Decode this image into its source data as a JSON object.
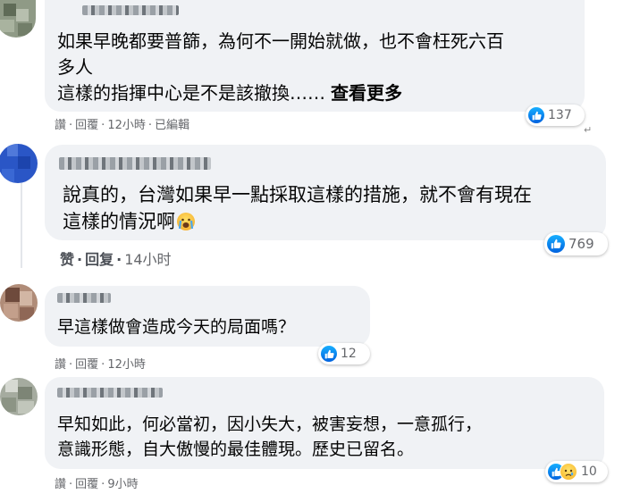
{
  "comments": [
    {
      "lines": [
        "如果早晚都要普篩，為何不一開始就做，也不會枉死六百",
        "多人",
        "這樣的指揮中心是不是該撤換……"
      ],
      "see_more": "查看更多",
      "actions": {
        "like": "讚",
        "reply": "回覆",
        "time": "12小時",
        "edited": "已編輯"
      },
      "reactions": {
        "icons": [
          "like-icon"
        ],
        "count": "137"
      }
    },
    {
      "lines": [
        "說真的，台灣如果早一點採取這樣的措施，就不會有現在",
        "這樣的情況啊"
      ],
      "emoji": "crying-face-icon",
      "actions": {
        "like": "赞",
        "reply": "回复",
        "time": "14小时"
      },
      "reactions": {
        "icons": [
          "like-icon"
        ],
        "count": "769"
      }
    },
    {
      "lines": [
        "早這樣做會造成今天的局面嗎？"
      ],
      "actions": {
        "like": "讚",
        "reply": "回覆",
        "time": "12小時"
      },
      "reactions": {
        "icons": [
          "like-icon"
        ],
        "count": "12"
      }
    },
    {
      "lines": [
        "早知如此，何必當初，因小失大，被害妄想，一意孤行，",
        "意識形態，自大傲慢的最佳體現。歷史已留名。"
      ],
      "actions": {
        "like": "讚",
        "reply": "回覆",
        "time": "9小時"
      },
      "reactions": {
        "icons": [
          "like-icon",
          "sad-icon"
        ],
        "count": "10"
      }
    }
  ],
  "colors": {
    "bubble": "#f0f2f5",
    "meta_text": "#65676b",
    "like_blue": "#1877f2"
  }
}
